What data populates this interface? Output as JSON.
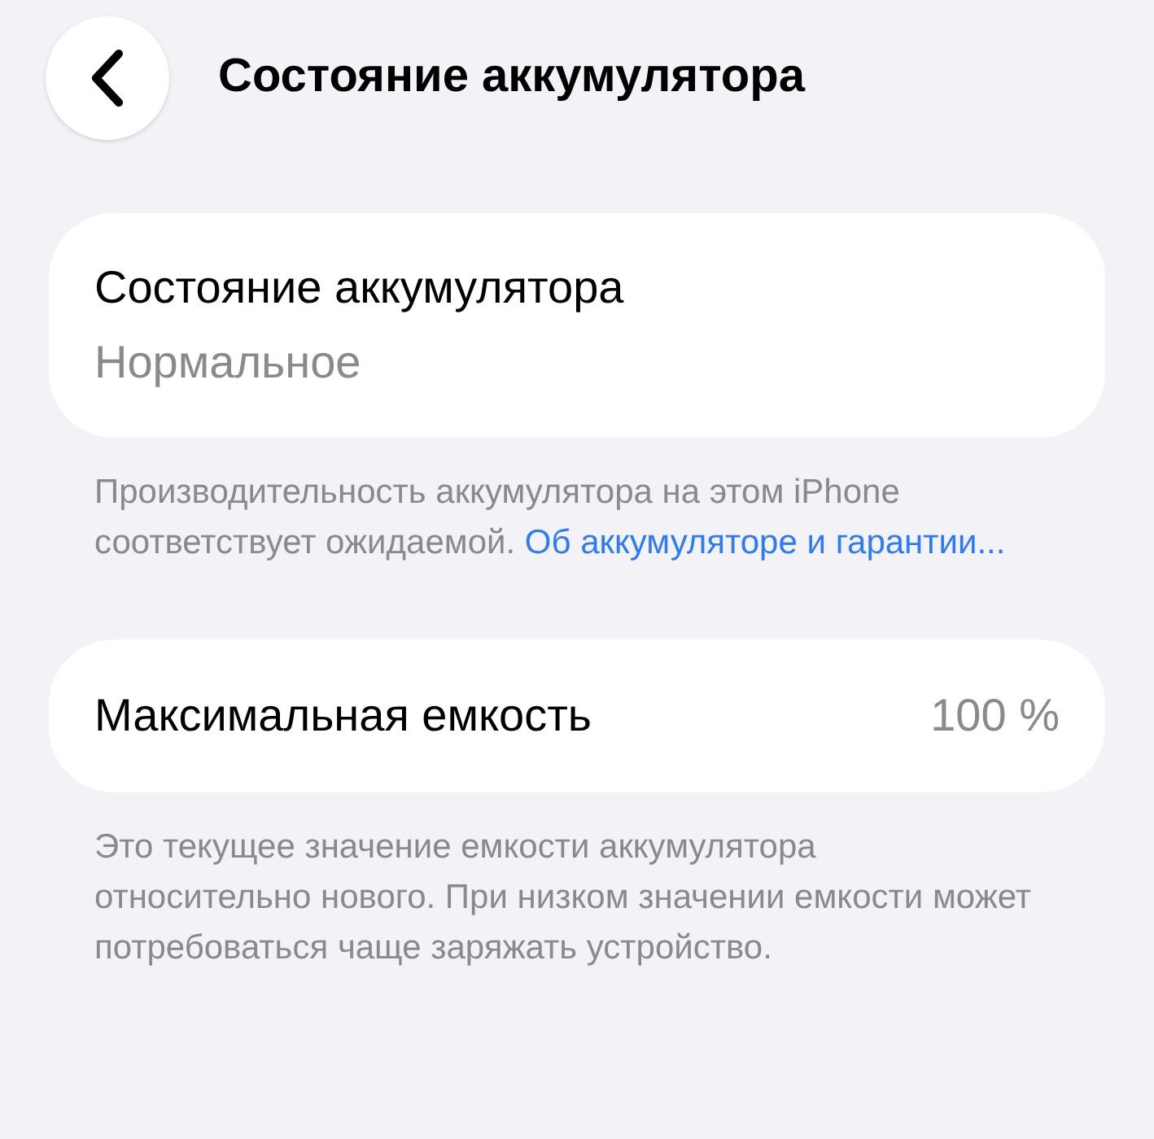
{
  "header": {
    "title": "Состояние аккумулятора"
  },
  "health_card": {
    "label": "Состояние аккумулятора",
    "value": "Нормальное"
  },
  "health_note": {
    "text": "Производительность аккумулятора на этом iPhone соответствует ожидаемой.",
    "link": "Об аккумуляторе и гарантии..."
  },
  "capacity_card": {
    "label": "Максимальная емкость",
    "value": "100 %"
  },
  "capacity_note": {
    "text": "Это текущее значение емкости аккумулятора относительно нового. При низком значении емкости может потребоваться чаще заряжать устройство."
  }
}
